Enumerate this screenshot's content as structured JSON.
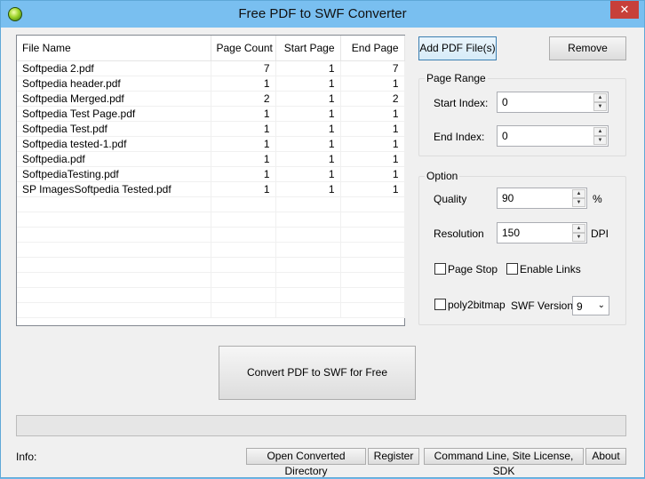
{
  "window": {
    "title": "Free PDF to SWF Converter",
    "close_glyph": "✕"
  },
  "file_list": {
    "columns": [
      "File Name",
      "Page Count",
      "Start Page",
      "End Page"
    ],
    "rows": [
      [
        "Softpedia 2.pdf",
        "7",
        "1",
        "7"
      ],
      [
        "Softpedia header.pdf",
        "1",
        "1",
        "1"
      ],
      [
        "Softpedia Merged.pdf",
        "2",
        "1",
        "2"
      ],
      [
        "Softpedia Test Page.pdf",
        "1",
        "1",
        "1"
      ],
      [
        "Softpedia Test.pdf",
        "1",
        "1",
        "1"
      ],
      [
        "Softpedia tested-1.pdf",
        "1",
        "1",
        "1"
      ],
      [
        "Softpedia.pdf",
        "1",
        "1",
        "1"
      ],
      [
        "SoftpediaTesting.pdf",
        "1",
        "1",
        "1"
      ],
      [
        "SP ImagesSoftpedia Tested.pdf",
        "1",
        "1",
        "1"
      ]
    ]
  },
  "buttons": {
    "add": "Add PDF File(s)",
    "remove": "Remove",
    "convert": "Convert PDF to SWF for Free",
    "open_dir": "Open Converted Directory",
    "register": "Register",
    "cmdline": "Command Line, Site License, SDK",
    "about": "About"
  },
  "page_range": {
    "title": "Page Range",
    "start_label": "Start Index:",
    "start_value": "0",
    "end_label": "End Index:",
    "end_value": "0"
  },
  "option": {
    "title": "Option",
    "quality_label": "Quality",
    "quality_value": "90",
    "quality_unit": "%",
    "resolution_label": "Resolution",
    "resolution_value": "150",
    "resolution_unit": "DPI",
    "page_stop_label": "Page Stop",
    "page_stop_checked": false,
    "enable_links_label": "Enable Links",
    "enable_links_checked": false,
    "poly2bitmap_label": "poly2bitmap",
    "poly2bitmap_checked": false,
    "swf_version_label": "SWF Version",
    "swf_version_value": "9"
  },
  "progress": {
    "value": 0
  },
  "footer": {
    "info_label": "Info:"
  },
  "icons": {
    "spin_up": "▲",
    "spin_down": "▼",
    "dropdown": "⌄"
  }
}
